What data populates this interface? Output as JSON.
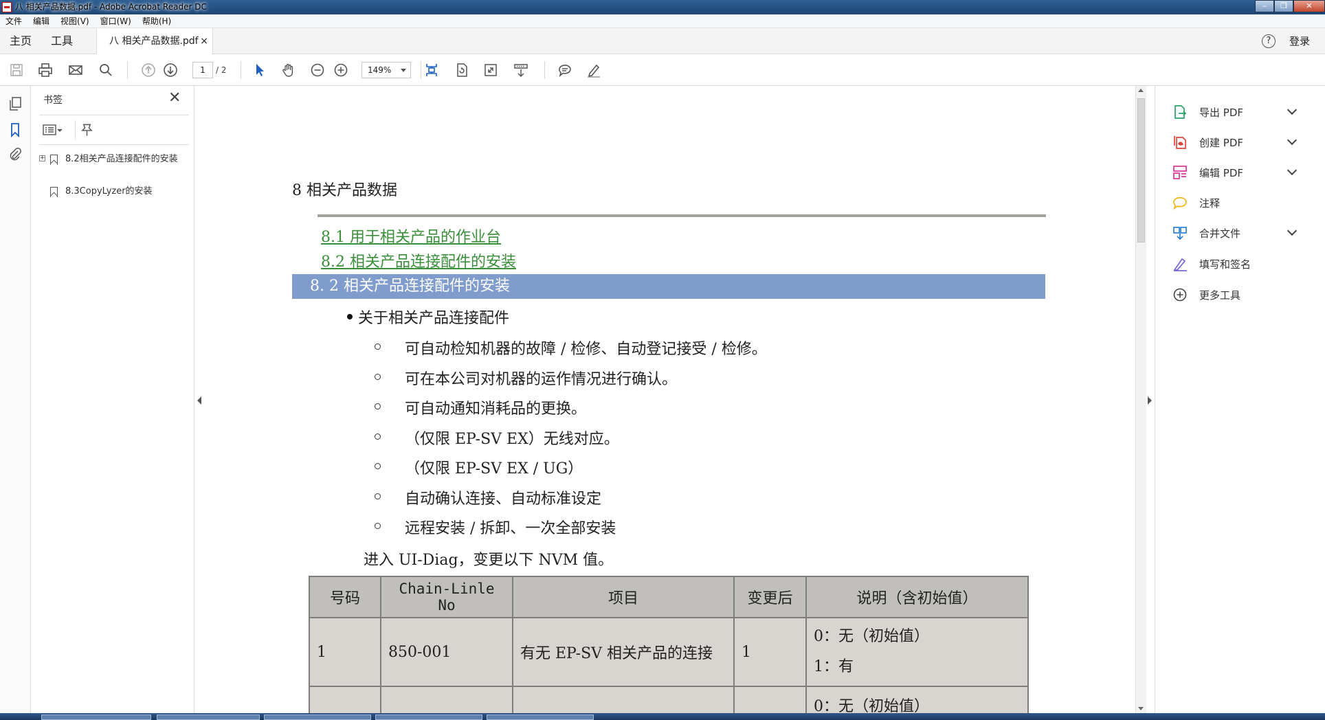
{
  "window": {
    "title": "八 相关产品数据.pdf - Adobe Acrobat Reader DC",
    "minimize": "‒",
    "restore": "❐",
    "close": "✕"
  },
  "menu": [
    "文件",
    "编辑",
    "视图(V)",
    "窗口(W)",
    "帮助(H)"
  ],
  "tabs": {
    "home": "主页",
    "tools": "工具",
    "document": "八 相关产品数据.pdf",
    "close": "×",
    "help": "?",
    "login": "登录"
  },
  "toolbar": {
    "page_current": "1",
    "page_total": "/ 2",
    "zoom": "149%"
  },
  "bookmarks": {
    "title": "书签",
    "close": "✕",
    "items": [
      {
        "label": "8.2相关产品连接配件的安装",
        "expander": "+"
      },
      {
        "label": "8.3CopyLyzer的安装"
      }
    ]
  },
  "document": {
    "title": "8  相关产品数据",
    "toc": [
      "8.1  用于相关产品的作业台",
      "8.2  相关产品连接配件的安装"
    ],
    "section_heading": "8. 2  相关产品连接配件的安装",
    "bullet": "关于相关产品连接配件",
    "sub_items": [
      "可自动检知机器的故障 / 检修、自动登记接受 / 检修。",
      "可在本公司对机器的运作情况进行确认。",
      "可自动通知消耗品的更换。",
      "（仅限 EP-SV EX）无线对应。",
      "（仅限 EP-SV EX / UG）",
      "自动确认连接、自动标准设定",
      "远程安装 / 拆卸、一次全部安装"
    ],
    "intro": "进入 UI-Diag，变更以下 NVM 值。",
    "table": {
      "headers": [
        "号码",
        "Chain-Linle No",
        "项目",
        "变更后",
        "说明（含初始值）"
      ],
      "rows": [
        {
          "no": "1",
          "chain": "850-001",
          "item": "有无 EP-SV 相关产品的连接",
          "after": "1",
          "desc": [
            "0：无（初始值）",
            "1：有"
          ]
        },
        {
          "no": "",
          "chain": "",
          "item": "",
          "after": "",
          "desc": [
            "0：无（初始值）"
          ]
        }
      ]
    }
  },
  "right_tools": [
    {
      "label": "导出 PDF",
      "icon": "export-pdf-icon",
      "color": "#2aa36b",
      "expandable": true
    },
    {
      "label": "创建 PDF",
      "icon": "create-pdf-icon",
      "color": "#e0443e",
      "expandable": true
    },
    {
      "label": "编辑 PDF",
      "icon": "edit-pdf-icon",
      "color": "#d8359a",
      "expandable": true
    },
    {
      "label": "注释",
      "icon": "comment-icon",
      "color": "#f2b824",
      "expandable": false
    },
    {
      "label": "合并文件",
      "icon": "combine-files-icon",
      "color": "#2a7fd4",
      "expandable": true
    },
    {
      "label": "填写和签名",
      "icon": "fill-sign-icon",
      "color": "#7b64d8",
      "expandable": false
    },
    {
      "label": "更多工具",
      "icon": "more-tools-icon",
      "color": "#444444",
      "expandable": false
    }
  ]
}
